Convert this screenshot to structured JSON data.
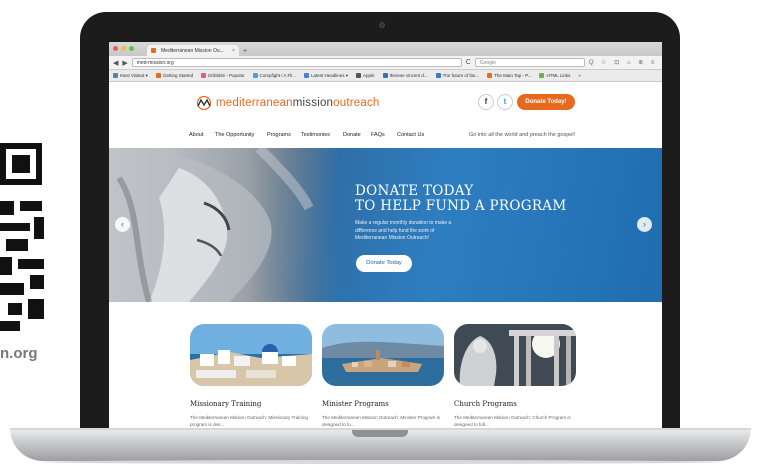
{
  "qr": {
    "caption": "n.org"
  },
  "browser": {
    "tab_title": "Mediterranean Mission Ou...",
    "tab_close": "×",
    "new_tab": "+",
    "url": "med-mission.org",
    "search_placeholder": "Google",
    "nav_back": "◀",
    "nav_forward": "▶",
    "reload": "C",
    "toolbar_icons": "Q ☆ ⊡ ⌂ ⊕ ≡",
    "bookmarks": [
      {
        "label": "Most Visited ▾",
        "color": "#5b7fb5"
      },
      {
        "label": "Getting Started",
        "color": "#e8681e"
      },
      {
        "label": "Dribbble - Popular",
        "color": "#e05c9a"
      },
      {
        "label": "Compfight / A Fli...",
        "color": "#4a9fd6"
      },
      {
        "label": "Latest Headlines ▾",
        "color": "#4a7fc9"
      },
      {
        "label": "Apple",
        "color": "#555555"
      },
      {
        "label": "therese vincent d...",
        "color": "#3a6fb5"
      },
      {
        "label": "The future of fas...",
        "color": "#3c7ac4"
      },
      {
        "label": "The Main Tap - P...",
        "color": "#e8681e"
      },
      {
        "label": "HTML Links",
        "color": "#6ab04c"
      },
      {
        "label": "»",
        "color": ""
      }
    ]
  },
  "site": {
    "logo_part1": "mediterranean",
    "logo_part2": "mission",
    "logo_part3": "outreach",
    "social_facebook": "f",
    "social_twitter": "t",
    "donate_today_btn": "Donate Today!",
    "nav": [
      "About",
      "The Opportunity",
      "Programs",
      "Testimonies",
      "Donate",
      "FAQs",
      "Contact Us"
    ],
    "tagline": "Go into all the world and preach the gospel!",
    "hero": {
      "title_line1": "DONATE TODAY",
      "title_line2": "TO HELP FUND A PROGRAM",
      "subtitle": "Make a regular monthly donation to make a difference and help fund the work of Mediterranean Mission Outreach!",
      "button": "Donate Today",
      "prev": "‹",
      "next": "›"
    },
    "cards": [
      {
        "title": "Missionary Training",
        "text": "The Mediterranean Mission Outreach: Missionary Training program is des..."
      },
      {
        "title": "Minister Programs",
        "text": "The Mediterranean Mission Outreach: Minister Program is designed to fu..."
      },
      {
        "title": "Church Programs",
        "text": "The Mediterranean Mission Outreach: Church Program is designed to full..."
      }
    ]
  },
  "colors": {
    "brand_orange": "#e8681e",
    "hero_blue": "#2d7ec1"
  }
}
